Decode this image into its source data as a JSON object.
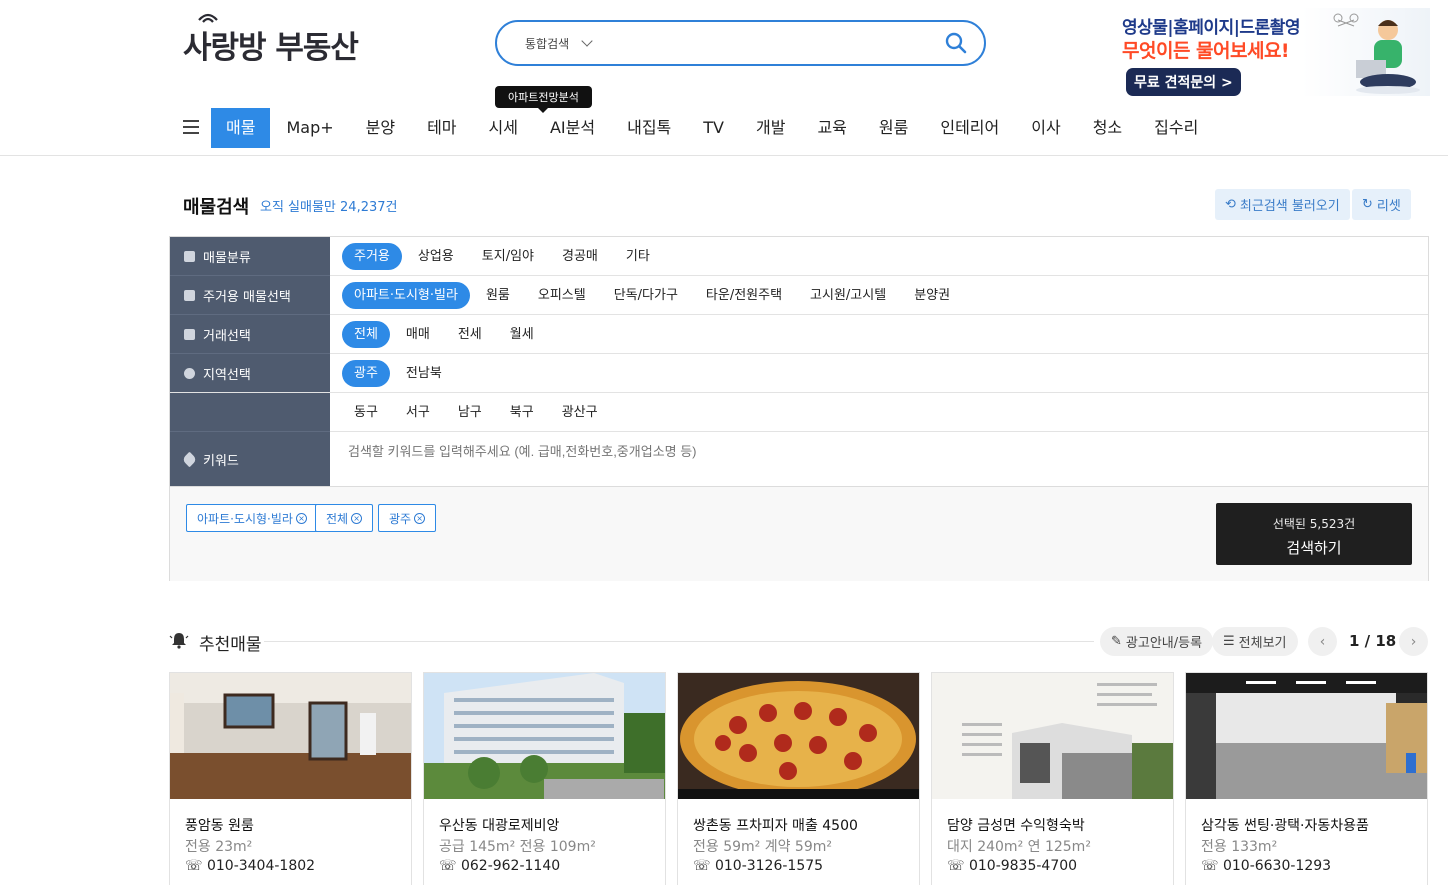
{
  "header": {
    "logo_main": "사랑방",
    "logo_sub": "부동산",
    "search_type": "통합검색",
    "search_placeholder": "",
    "banner": {
      "line1": "영상물|홈페이지|드론촬영",
      "line2": "무엇이든 물어보세요!",
      "cta": "무료 견적문의 >"
    }
  },
  "nav": {
    "items": [
      "매물",
      "Map+",
      "분양",
      "테마",
      "시세",
      "AI분석",
      "내집톡",
      "TV",
      "개발",
      "교육",
      "원룸",
      "인테리어",
      "이사",
      "청소",
      "집수리"
    ],
    "active": "매물",
    "tooltip": "아파트전망분석"
  },
  "search_section": {
    "title": "매물검색",
    "subtitle": "오직 실매물만 24,237건",
    "recent_btn": "최근검색 불러오기",
    "reset_btn": "리셋",
    "rows": [
      {
        "label": "매물분류",
        "options": [
          "주거용",
          "상업용",
          "토지/임야",
          "경공매",
          "기타"
        ],
        "selected": "주거용"
      },
      {
        "label": "주거용 매물선택",
        "options": [
          "아파트·도시형·빌라",
          "원룸",
          "오피스텔",
          "단독/다가구",
          "타운/전원주택",
          "고시원/고시텔",
          "분양권"
        ],
        "selected": "아파트·도시형·빌라"
      },
      {
        "label": "거래선택",
        "options": [
          "전체",
          "매매",
          "전세",
          "월세"
        ],
        "selected": "전체"
      },
      {
        "label": "지역선택",
        "options": [
          "광주",
          "전남북"
        ],
        "selected": "광주"
      },
      {
        "label": "",
        "options": [
          "동구",
          "서구",
          "남구",
          "북구",
          "광산구"
        ],
        "selected": ""
      }
    ],
    "keyword_label": "키워드",
    "keyword_placeholder": "검색할 키워드를 입력해주세요 (예. 급매,전화번호,중개업소명 등)",
    "chips": [
      "아파트·도시형·빌라",
      "전체",
      "광주"
    ],
    "selected_count": "선택된 5,523건",
    "search_btn": "검색하기"
  },
  "recommend": {
    "title": "추천매물",
    "ad_btn": "광고안내/등록",
    "all_btn": "전체보기",
    "pager": "1 / 18",
    "cards": [
      {
        "title": "풍암동 원룸",
        "spec": "전용 23m²",
        "phone": "010-3404-1802"
      },
      {
        "title": "우산동 대광로제비앙",
        "spec": "공급 145m²   전용 109m²",
        "phone": "062-962-1140"
      },
      {
        "title": "쌍촌동 프차피자 매출 4500",
        "spec": "전용 59m²   계약 59m²",
        "phone": "010-3126-1575"
      },
      {
        "title": "담양 금성면 수익형숙박",
        "spec": "대지 240m²   연 125m²",
        "phone": "010-9835-4700"
      },
      {
        "title": "삼각동 썬팅·광택·자동차용품",
        "spec": "전용 133m²",
        "phone": "010-6630-1293"
      }
    ]
  }
}
